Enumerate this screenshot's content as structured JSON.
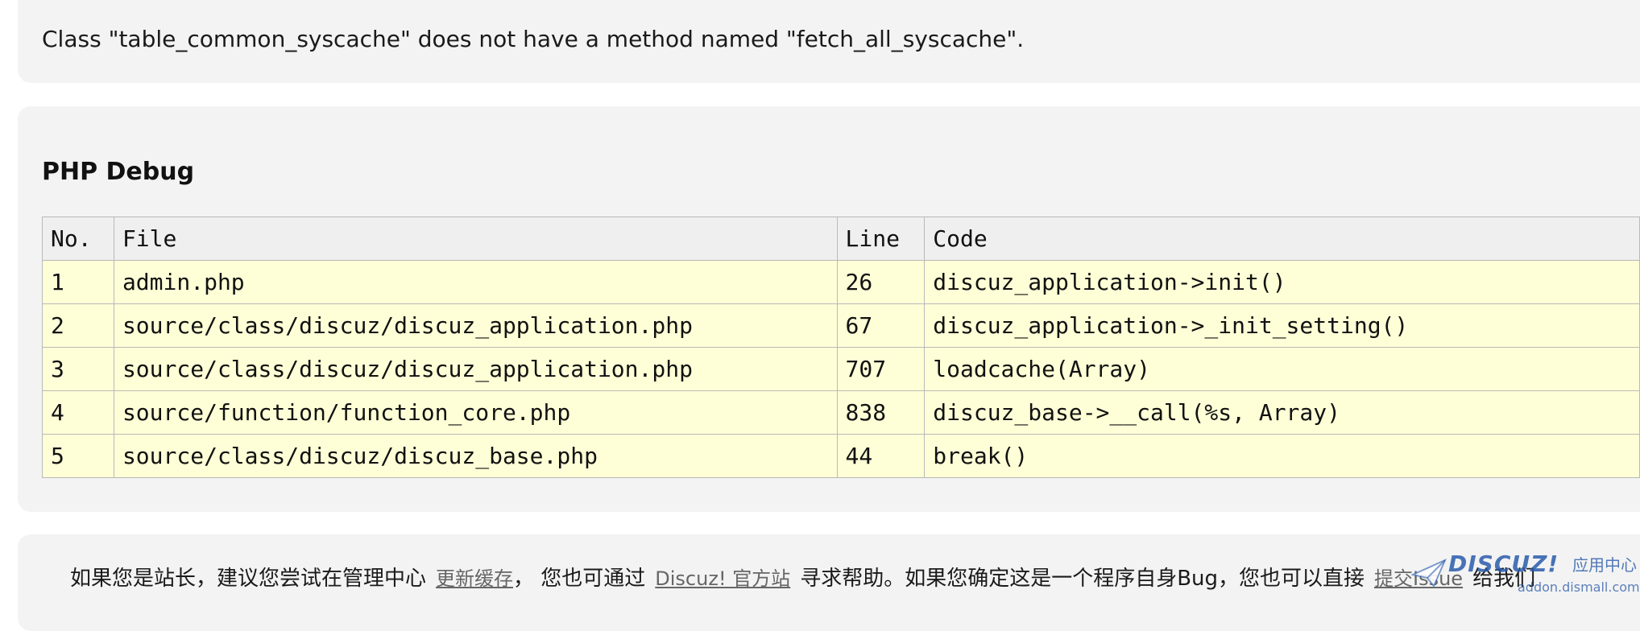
{
  "error": {
    "message": "Class \"table_common_syscache\" does not have a method named \"fetch_all_syscache\"."
  },
  "debug": {
    "title": "PHP Debug",
    "columns": [
      "No.",
      "File",
      "Line",
      "Code"
    ],
    "rows": [
      {
        "no": "1",
        "file": "admin.php",
        "line": "26",
        "code": "discuz_application->init()"
      },
      {
        "no": "2",
        "file": "source/class/discuz/discuz_application.php",
        "line": "67",
        "code": "discuz_application->_init_setting()"
      },
      {
        "no": "3",
        "file": "source/class/discuz/discuz_application.php",
        "line": "707",
        "code": "loadcache(Array)"
      },
      {
        "no": "4",
        "file": "source/function/function_core.php",
        "line": "838",
        "code": "discuz_base->__call(%s, Array)"
      },
      {
        "no": "5",
        "file": "source/class/discuz/discuz_base.php",
        "line": "44",
        "code": "break()"
      }
    ]
  },
  "help": {
    "text1": "如果您是站长，建议您尝试在管理中心",
    "link_update_cache": "更新缓存",
    "text2": "，  您也可通过",
    "link_official": "Discuz! 官方站",
    "text3": "寻求帮助。如果您确定这是一个程序自身Bug，您也可以直接",
    "link_issue": "提交Issue",
    "text4": "给我们"
  },
  "watermark": {
    "brand": "DISCUZ!",
    "sub": "应用中心",
    "url": "addon.dismall.com"
  },
  "colors": {
    "panel_bg": "#f3f3f3",
    "header_bg": "#efefef",
    "row_bg": "#ffffd7",
    "border": "#b9b9b9",
    "link": "#666666",
    "watermark": "#285aaa"
  }
}
